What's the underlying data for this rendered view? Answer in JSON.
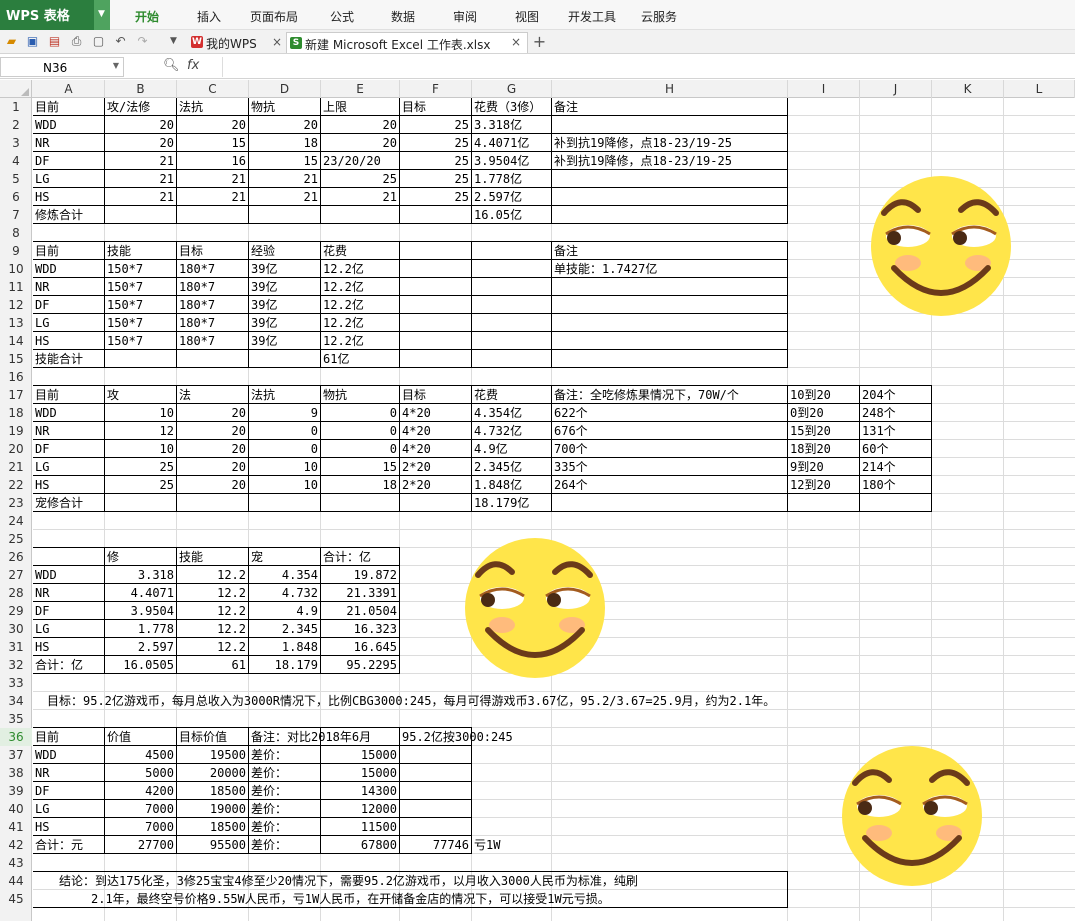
{
  "app": {
    "name": "WPS 表格"
  },
  "menu": [
    "开始",
    "插入",
    "页面布局",
    "公式",
    "数据",
    "审阅",
    "视图",
    "开发工具",
    "云服务"
  ],
  "tabs": [
    {
      "label": "我的WPS",
      "icon": "wps-icon"
    },
    {
      "label": "新建 Microsoft Excel 工作表.xlsx",
      "icon": "excel-icon"
    }
  ],
  "formula_bar": {
    "name_box": "N36",
    "fx": "fx",
    "value": ""
  },
  "columns": [
    "A",
    "B",
    "C",
    "D",
    "E",
    "F",
    "G",
    "H",
    "I",
    "J",
    "K",
    "L"
  ],
  "rows": [
    "1",
    "2",
    "3",
    "4",
    "5",
    "6",
    "7",
    "8",
    "9",
    "10",
    "11",
    "12",
    "13",
    "14",
    "15",
    "16",
    "17",
    "18",
    "19",
    "20",
    "21",
    "22",
    "23",
    "24",
    "25",
    "26",
    "27",
    "28",
    "29",
    "30",
    "31",
    "32",
    "33",
    "34",
    "35",
    "36",
    "37",
    "38",
    "39",
    "40",
    "41",
    "42",
    "43",
    "44",
    "45"
  ],
  "selected_row": "36",
  "accent_color": "#2e8b2e",
  "cells": [
    [
      "A1",
      "目前"
    ],
    [
      "B1",
      "攻/法修"
    ],
    [
      "C1",
      "法抗"
    ],
    [
      "D1",
      "物抗"
    ],
    [
      "E1",
      "上限"
    ],
    [
      "F1",
      "目标"
    ],
    [
      "G1",
      "花费（3修）"
    ],
    [
      "H1",
      "备注"
    ],
    [
      "A2",
      "WDD"
    ],
    [
      "B2",
      "20"
    ],
    [
      "C2",
      "20"
    ],
    [
      "D2",
      "20"
    ],
    [
      "E2",
      "20"
    ],
    [
      "F2",
      "25"
    ],
    [
      "G2",
      "3.318亿"
    ],
    [
      "A3",
      "NR"
    ],
    [
      "B3",
      "20"
    ],
    [
      "C3",
      "15"
    ],
    [
      "D3",
      "18"
    ],
    [
      "E3",
      "20"
    ],
    [
      "F3",
      "25"
    ],
    [
      "G3",
      "4.4071亿"
    ],
    [
      "H3",
      "补到抗19降修，点18-23/19-25"
    ],
    [
      "A4",
      "DF"
    ],
    [
      "B4",
      "21"
    ],
    [
      "C4",
      "16"
    ],
    [
      "D4",
      "15"
    ],
    [
      "E4",
      "23/20/20"
    ],
    [
      "F4",
      "25"
    ],
    [
      "G4",
      "3.9504亿"
    ],
    [
      "H4",
      "补到抗19降修，点18-23/19-25"
    ],
    [
      "A5",
      "LG"
    ],
    [
      "B5",
      "21"
    ],
    [
      "C5",
      "21"
    ],
    [
      "D5",
      "21"
    ],
    [
      "E5",
      "25"
    ],
    [
      "F5",
      "25"
    ],
    [
      "G5",
      "1.778亿"
    ],
    [
      "A6",
      "HS"
    ],
    [
      "B6",
      "21"
    ],
    [
      "C6",
      "21"
    ],
    [
      "D6",
      "21"
    ],
    [
      "E6",
      "21"
    ],
    [
      "F6",
      "25"
    ],
    [
      "G6",
      "2.597亿"
    ],
    [
      "A7",
      "修炼合计"
    ],
    [
      "G7",
      "16.05亿"
    ],
    [
      "A9",
      "目前"
    ],
    [
      "B9",
      "技能"
    ],
    [
      "C9",
      "目标"
    ],
    [
      "D9",
      "经验"
    ],
    [
      "E9",
      "花费"
    ],
    [
      "H9",
      "备注"
    ],
    [
      "A10",
      "WDD"
    ],
    [
      "B10",
      "150*7"
    ],
    [
      "C10",
      "180*7"
    ],
    [
      "D10",
      "39亿"
    ],
    [
      "E10",
      "12.2亿"
    ],
    [
      "H10",
      "单技能：1.7427亿"
    ],
    [
      "A11",
      "NR"
    ],
    [
      "B11",
      "150*7"
    ],
    [
      "C11",
      "180*7"
    ],
    [
      "D11",
      "39亿"
    ],
    [
      "E11",
      "12.2亿"
    ],
    [
      "A12",
      "DF"
    ],
    [
      "B12",
      "150*7"
    ],
    [
      "C12",
      "180*7"
    ],
    [
      "D12",
      "39亿"
    ],
    [
      "E12",
      "12.2亿"
    ],
    [
      "A13",
      "LG"
    ],
    [
      "B13",
      "150*7"
    ],
    [
      "C13",
      "180*7"
    ],
    [
      "D13",
      "39亿"
    ],
    [
      "E13",
      "12.2亿"
    ],
    [
      "A14",
      "HS"
    ],
    [
      "B14",
      "150*7"
    ],
    [
      "C14",
      "180*7"
    ],
    [
      "D14",
      "39亿"
    ],
    [
      "E14",
      "12.2亿"
    ],
    [
      "A15",
      "技能合计"
    ],
    [
      "E15",
      "61亿"
    ],
    [
      "A17",
      "目前"
    ],
    [
      "B17",
      "攻"
    ],
    [
      "C17",
      "法"
    ],
    [
      "D17",
      "法抗"
    ],
    [
      "E17",
      "物抗"
    ],
    [
      "F17",
      "目标"
    ],
    [
      "G17",
      "花费"
    ],
    [
      "H17",
      "备注：全吃修炼果情况下，70W/个"
    ],
    [
      "I17",
      "10到20"
    ],
    [
      "J17",
      "204个"
    ],
    [
      "A18",
      "WDD"
    ],
    [
      "B18",
      "10"
    ],
    [
      "C18",
      "20"
    ],
    [
      "D18",
      "9"
    ],
    [
      "E18",
      "0"
    ],
    [
      "F18",
      "4*20"
    ],
    [
      "G18",
      "4.354亿"
    ],
    [
      "H18",
      "622个"
    ],
    [
      "I18",
      "0到20"
    ],
    [
      "J18",
      "248个"
    ],
    [
      "A19",
      "NR"
    ],
    [
      "B19",
      "12"
    ],
    [
      "C19",
      "20"
    ],
    [
      "D19",
      "0"
    ],
    [
      "E19",
      "0"
    ],
    [
      "F19",
      "4*20"
    ],
    [
      "G19",
      "4.732亿"
    ],
    [
      "H19",
      "676个"
    ],
    [
      "I19",
      "15到20"
    ],
    [
      "J19",
      "131个"
    ],
    [
      "A20",
      "DF"
    ],
    [
      "B20",
      "10"
    ],
    [
      "C20",
      "20"
    ],
    [
      "D20",
      "0"
    ],
    [
      "E20",
      "0"
    ],
    [
      "F20",
      "4*20"
    ],
    [
      "G20",
      "4.9亿"
    ],
    [
      "H20",
      "700个"
    ],
    [
      "I20",
      "18到20"
    ],
    [
      "J20",
      "60个"
    ],
    [
      "A21",
      "LG"
    ],
    [
      "B21",
      "25"
    ],
    [
      "C21",
      "20"
    ],
    [
      "D21",
      "10"
    ],
    [
      "E21",
      "15"
    ],
    [
      "F21",
      "2*20"
    ],
    [
      "G21",
      "2.345亿"
    ],
    [
      "H21",
      "335个"
    ],
    [
      "I21",
      "9到20"
    ],
    [
      "J21",
      "214个"
    ],
    [
      "A22",
      "HS"
    ],
    [
      "B22",
      "25"
    ],
    [
      "C22",
      "20"
    ],
    [
      "D22",
      "10"
    ],
    [
      "E22",
      "18"
    ],
    [
      "F22",
      "2*20"
    ],
    [
      "G22",
      "1.848亿"
    ],
    [
      "H22",
      "264个"
    ],
    [
      "I22",
      "12到20"
    ],
    [
      "J22",
      "180个"
    ],
    [
      "A23",
      "宠修合计"
    ],
    [
      "G23",
      "18.179亿"
    ],
    [
      "B26",
      "修"
    ],
    [
      "C26",
      "技能"
    ],
    [
      "D26",
      "宠"
    ],
    [
      "E26",
      "合计：亿"
    ],
    [
      "A27",
      "WDD"
    ],
    [
      "B27",
      "3.318"
    ],
    [
      "C27",
      "12.2"
    ],
    [
      "D27",
      "4.354"
    ],
    [
      "E27",
      "19.872"
    ],
    [
      "A28",
      "NR"
    ],
    [
      "B28",
      "4.4071"
    ],
    [
      "C28",
      "12.2"
    ],
    [
      "D28",
      "4.732"
    ],
    [
      "E28",
      "21.3391"
    ],
    [
      "A29",
      "DF"
    ],
    [
      "B29",
      "3.9504"
    ],
    [
      "C29",
      "12.2"
    ],
    [
      "D29",
      "4.9"
    ],
    [
      "E29",
      "21.0504"
    ],
    [
      "A30",
      "LG"
    ],
    [
      "B30",
      "1.778"
    ],
    [
      "C30",
      "12.2"
    ],
    [
      "D30",
      "2.345"
    ],
    [
      "E30",
      "16.323"
    ],
    [
      "A31",
      "HS"
    ],
    [
      "B31",
      "2.597"
    ],
    [
      "C31",
      "12.2"
    ],
    [
      "D31",
      "1.848"
    ],
    [
      "E31",
      "16.645"
    ],
    [
      "A32",
      "合计：亿"
    ],
    [
      "B32",
      "16.0505"
    ],
    [
      "C32",
      "61"
    ],
    [
      "D32",
      "18.179"
    ],
    [
      "E32",
      "95.2295"
    ],
    [
      "A34",
      "　目标：95.2亿游戏币，每月总收入为3000R情况下，比例CBG3000:245，每月可得游戏币3.67亿，95.2/3.67=25.9月，约为2.1年。"
    ],
    [
      "A36",
      "目前"
    ],
    [
      "B36",
      "价值"
    ],
    [
      "C36",
      "目标价值"
    ],
    [
      "D36",
      "备注：对比2018年6月"
    ],
    [
      "F36",
      "95.2亿按3000:245"
    ],
    [
      "A37",
      "WDD"
    ],
    [
      "B37",
      "4500"
    ],
    [
      "C37",
      "19500"
    ],
    [
      "D37",
      "差价："
    ],
    [
      "E37",
      "15000"
    ],
    [
      "A38",
      "NR"
    ],
    [
      "B38",
      "5000"
    ],
    [
      "C38",
      "20000"
    ],
    [
      "D38",
      "差价："
    ],
    [
      "E38",
      "15000"
    ],
    [
      "A39",
      "DF"
    ],
    [
      "B39",
      "4200"
    ],
    [
      "C39",
      "18500"
    ],
    [
      "D39",
      "差价："
    ],
    [
      "E39",
      "14300"
    ],
    [
      "A40",
      "LG"
    ],
    [
      "B40",
      "7000"
    ],
    [
      "C40",
      "19000"
    ],
    [
      "D40",
      "差价："
    ],
    [
      "E40",
      "12000"
    ],
    [
      "A41",
      "HS"
    ],
    [
      "B41",
      "7000"
    ],
    [
      "C41",
      "18500"
    ],
    [
      "D41",
      "差价："
    ],
    [
      "E41",
      "11500"
    ],
    [
      "A42",
      "合计：元"
    ],
    [
      "B42",
      "27700"
    ],
    [
      "C42",
      "95500"
    ],
    [
      "D42",
      "差价："
    ],
    [
      "E42",
      "67800"
    ],
    [
      "F42",
      "77746"
    ],
    [
      "G42",
      "亏1W"
    ]
  ],
  "conclusion": {
    "line1": "结论：到达175化圣，3修25宝宝4修至少20情况下，需要95.2亿游戏币，以月收入3000人民币为标准，纯刷",
    "line2": "2.1年，最终空号价格9.55W人民币，亏1W人民币，在开储备金店的情况下，可以接受1W元亏损。"
  },
  "images": [
    "smirk-emoji",
    "smirk-emoji",
    "smirk-emoji"
  ]
}
